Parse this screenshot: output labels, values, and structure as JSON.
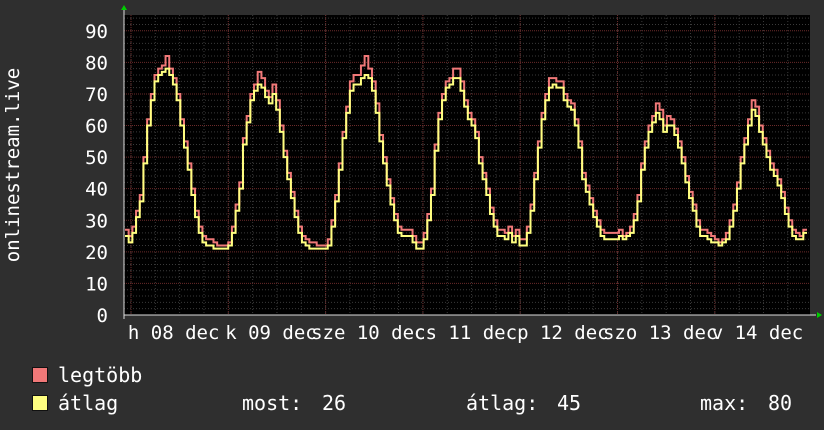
{
  "chart_data": {
    "type": "line",
    "ylabel": "onlinestream.live",
    "ylim": [
      0,
      95
    ],
    "yticks": [
      0,
      10,
      20,
      30,
      40,
      50,
      60,
      70,
      80,
      90
    ],
    "x_tick_labels": [
      "h 08 dec",
      "k 09 dec",
      "sze 10 dec",
      "cs 11 dec",
      "p 12 dec",
      "szo 13 dec",
      "v 14 dec"
    ],
    "grid": true,
    "series": [
      {
        "name": "legtöbb",
        "color": "#f07878",
        "values": [
          27,
          25,
          28,
          33,
          38,
          50,
          62,
          70,
          76,
          78,
          79,
          82,
          78,
          75,
          70,
          62,
          55,
          48,
          40,
          33,
          28,
          25,
          24,
          24,
          23,
          22,
          22,
          22,
          23,
          28,
          35,
          42,
          56,
          63,
          70,
          73,
          77,
          75,
          71,
          69,
          73,
          68,
          60,
          52,
          45,
          39,
          33,
          28,
          25,
          24,
          23,
          23,
          22,
          22,
          22,
          24,
          30,
          38,
          48,
          58,
          66,
          74,
          76,
          76,
          79,
          82,
          78,
          74,
          67,
          57,
          50,
          43,
          37,
          32,
          28,
          27,
          27,
          27,
          25,
          23,
          23,
          26,
          32,
          40,
          54,
          64,
          70,
          74,
          75,
          78,
          78,
          74,
          68,
          64,
          62,
          58,
          50,
          45,
          40,
          34,
          30,
          27,
          27,
          26,
          28,
          25,
          27,
          24,
          24,
          28,
          35,
          45,
          55,
          64,
          70,
          75,
          75,
          74,
          74,
          70,
          68,
          67,
          62,
          55,
          45,
          41,
          37,
          33,
          30,
          27,
          26,
          26,
          26,
          26,
          27,
          25,
          26,
          28,
          32,
          38,
          48,
          55,
          60,
          63,
          67,
          65,
          60,
          63,
          62,
          59,
          55,
          50,
          44,
          39,
          35,
          30,
          27,
          27,
          26,
          25,
          24,
          23,
          24,
          26,
          30,
          35,
          42,
          50,
          56,
          62,
          68,
          66,
          60,
          56,
          52,
          48,
          46,
          43,
          39,
          34,
          30,
          27,
          26,
          25,
          27
        ],
        "style": "step"
      },
      {
        "name": "átlag",
        "color": "#ffff80",
        "values": [
          25,
          23,
          26,
          31,
          36,
          48,
          60,
          68,
          74,
          76,
          77,
          78,
          76,
          73,
          68,
          60,
          53,
          46,
          38,
          31,
          26,
          23,
          22,
          22,
          21,
          21,
          21,
          21,
          22,
          26,
          33,
          40,
          54,
          61,
          68,
          71,
          73,
          72,
          69,
          67,
          70,
          65,
          58,
          50,
          43,
          37,
          31,
          26,
          23,
          22,
          21,
          21,
          21,
          21,
          21,
          22,
          28,
          36,
          46,
          56,
          64,
          71,
          73,
          73,
          75,
          76,
          75,
          71,
          64,
          55,
          48,
          41,
          35,
          30,
          26,
          25,
          25,
          25,
          23,
          21,
          21,
          24,
          30,
          38,
          52,
          62,
          68,
          72,
          73,
          75,
          75,
          71,
          66,
          62,
          60,
          56,
          48,
          43,
          38,
          32,
          28,
          25,
          25,
          24,
          26,
          23,
          25,
          22,
          22,
          26,
          33,
          43,
          53,
          62,
          68,
          72,
          73,
          72,
          72,
          68,
          66,
          65,
          60,
          53,
          43,
          39,
          35,
          31,
          28,
          25,
          24,
          24,
          24,
          24,
          25,
          24,
          25,
          26,
          30,
          36,
          46,
          53,
          58,
          61,
          64,
          62,
          58,
          60,
          60,
          57,
          53,
          48,
          42,
          37,
          33,
          28,
          25,
          25,
          24,
          23,
          23,
          22,
          23,
          24,
          28,
          33,
          40,
          48,
          54,
          60,
          65,
          63,
          58,
          54,
          50,
          46,
          44,
          41,
          37,
          32,
          28,
          25,
          24,
          24,
          26
        ],
        "style": "step"
      }
    ]
  },
  "legend": {
    "items": [
      {
        "label": "legtöbb",
        "color": "#f07878"
      },
      {
        "label": "átlag",
        "color": "#ffff80"
      }
    ]
  },
  "stats": {
    "now_label": "most:",
    "now_value": "26",
    "avg_label": "átlag:",
    "avg_value": "45",
    "max_label": "max:",
    "max_value": "80"
  }
}
